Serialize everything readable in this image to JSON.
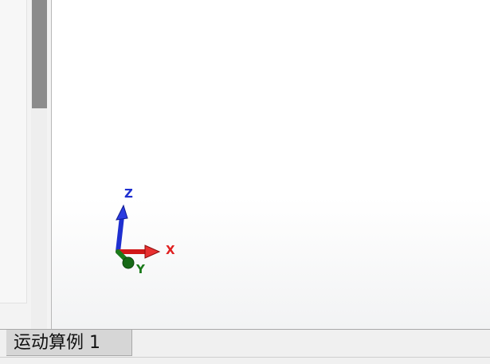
{
  "viewport": {
    "triad": {
      "x_label": "X",
      "y_label": "Y",
      "z_label": "Z",
      "x_color": "#e02020",
      "y_color": "#1a7a1a",
      "z_color": "#1e2fd0"
    }
  },
  "study_tabs": [
    {
      "label": "运动算例 1",
      "active": true
    }
  ]
}
